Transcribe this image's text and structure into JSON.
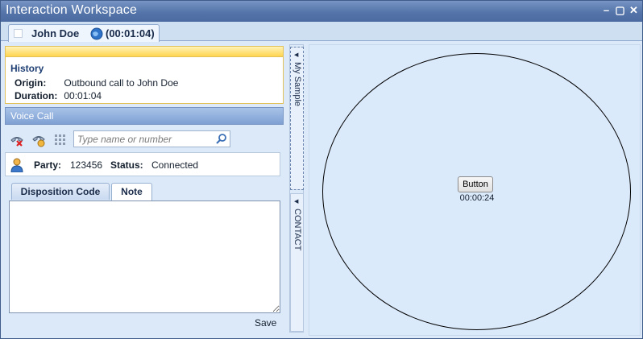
{
  "window": {
    "title": "Interaction Workspace"
  },
  "interaction_tab": {
    "name": "John Doe",
    "timer": "(00:01:04)"
  },
  "history": {
    "heading": "History",
    "origin_label": "Origin:",
    "origin_value": "Outbound call to John Doe",
    "duration_label": "Duration:",
    "duration_value": "00:01:04"
  },
  "voice_call": {
    "label": "Voice Call"
  },
  "search": {
    "placeholder": "Type name or number"
  },
  "party": {
    "party_label": "Party:",
    "party_value": "123456",
    "status_label": "Status:",
    "status_value": "Connected"
  },
  "tabs": {
    "disposition": "Disposition Code",
    "note": "Note"
  },
  "note": {
    "value": ""
  },
  "save_label": "Save",
  "side_tabs": {
    "my_sample": "My Sample",
    "contact": "CONTACT"
  },
  "sample": {
    "button_label": "Button",
    "timer": "00:00:24"
  },
  "icons": {
    "hangup": "hangup-icon",
    "hold": "hold-icon",
    "dialpad": "dialpad-icon",
    "search": "search-icon",
    "agent": "person-icon",
    "globe": "globe-icon"
  },
  "colors": {
    "titlebar": "#5575aa",
    "history_bar": "#ffd44f",
    "background": "#dce9f8"
  }
}
